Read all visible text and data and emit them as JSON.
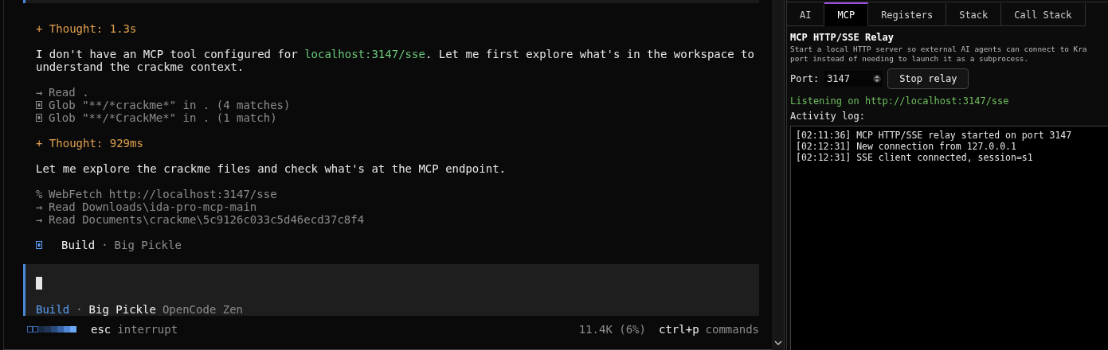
{
  "terminal": {
    "blocks": [
      {
        "kind": "thought",
        "text": "+ Thought: 1.3s"
      },
      {
        "kind": "paragraph",
        "segments": [
          {
            "text": "I don't have an MCP tool configured for ",
            "code": false
          },
          {
            "text": "localhost:3147/sse",
            "code": true
          },
          {
            "text": ". Let me first explore what's in the workspace to understand the crackme context.",
            "code": false
          }
        ]
      },
      {
        "kind": "tools",
        "items": [
          {
            "kind": "glyph",
            "glyph": "→",
            "text": "Read ."
          },
          {
            "kind": "missing-glyph",
            "text": "Glob \"**/*crackme*\" in . (4 matches)"
          },
          {
            "kind": "missing-glyph",
            "text": "Glob \"**/*CrackMe*\" in . (1 match)"
          }
        ]
      },
      {
        "kind": "thought",
        "text": "+ Thought: 929ms"
      },
      {
        "kind": "paragraph",
        "segments": [
          {
            "text": "Let me explore the crackme files and check what's at the MCP endpoint.",
            "code": false
          }
        ]
      },
      {
        "kind": "tools",
        "items": [
          {
            "kind": "glyph",
            "glyph": "%",
            "text": "WebFetch http://localhost:3147/sse"
          },
          {
            "kind": "glyph",
            "glyph": "→",
            "text": "Read Downloads\\ida-pro-mcp-main"
          },
          {
            "kind": "glyph",
            "glyph": "→",
            "text": "Read Documents\\crackme\\5c9126c033c5d46ecd37c8f4"
          }
        ]
      },
      {
        "kind": "agent",
        "agent": "Build",
        "separator": "·",
        "model": "Big Pickle"
      }
    ],
    "prompt": {
      "agent": "Build",
      "separator": "·",
      "model": "Big Pickle",
      "provider": "OpenCode Zen"
    },
    "status_bar": {
      "key": "esc",
      "action": "interrupt",
      "tokens": "11.4K (6%)",
      "shortcut_key": "ctrl+p",
      "shortcut_action": "commands"
    }
  },
  "panel": {
    "tabs": [
      {
        "label": "AI",
        "selected": false
      },
      {
        "label": "MCP",
        "selected": true
      },
      {
        "label": "Registers",
        "selected": false
      },
      {
        "label": "Stack",
        "selected": false
      },
      {
        "label": "Call Stack",
        "selected": false
      }
    ],
    "heading": "MCP HTTP/SSE Relay",
    "description": [
      "Start a local HTTP server so external AI agents can connect to Kra",
      "port instead of needing to launch it as a subprocess."
    ],
    "port_label": "Port:",
    "port_value": "3147",
    "button": "Stop relay",
    "status": "Listening on http://localhost:3147/sse",
    "log_label": "Activity log:",
    "log": [
      "[02:11:36] MCP HTTP/SSE relay started on port 3147",
      "[02:12:31] New connection from 127.0.0.1",
      "[02:12:31] SSE client connected, session=s1"
    ]
  }
}
